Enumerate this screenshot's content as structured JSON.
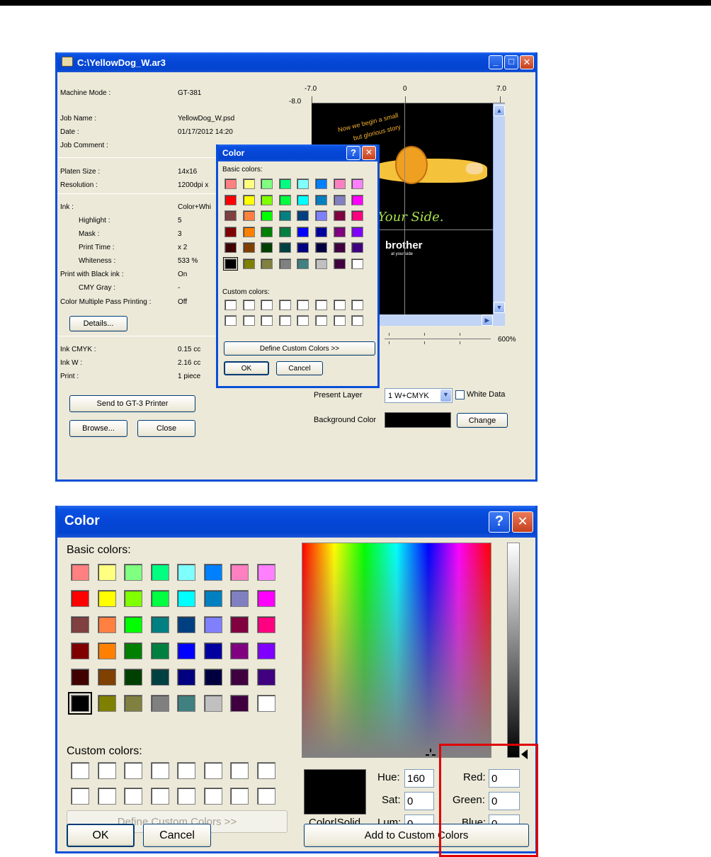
{
  "main_window": {
    "title": "C:\\YellowDog_W.ar3",
    "info": [
      {
        "label": "Machine Mode :",
        "value": "GT-381"
      },
      {
        "label": "Job Name :",
        "value": "YellowDog_W.psd"
      },
      {
        "label": "Date :",
        "value": "01/17/2012 14:20"
      },
      {
        "label": "Job Comment :",
        "value": ""
      },
      {
        "label": "Platen Size :",
        "value": "14x16"
      },
      {
        "label": "Resolution :",
        "value": "1200dpi x"
      },
      {
        "label": "Ink :",
        "value": "Color+Whi"
      },
      {
        "label": "Highlight :",
        "value": "5"
      },
      {
        "label": "Mask :",
        "value": "3"
      },
      {
        "label": "Print Time :",
        "value": "x 2"
      },
      {
        "label": "Whiteness :",
        "value": "533 %"
      },
      {
        "label": "Print with Black ink :",
        "value": "On"
      },
      {
        "label": "CMY Gray :",
        "value": "-"
      },
      {
        "label": "Color Multiple Pass Printing :",
        "value": "Off"
      },
      {
        "label": "Ink CMYK :",
        "value": "0.15 cc"
      },
      {
        "label": "Ink W :",
        "value": "2.16 cc"
      },
      {
        "label": "Print :",
        "value": "1 piece"
      }
    ],
    "details_button": "Details...",
    "send_button": "Send to GT-3 Printer",
    "browse_button": "Browse...",
    "close_button": "Close",
    "ruler": {
      "left": "-7.0",
      "center": "0",
      "right": "7.0",
      "top": "-8.0"
    },
    "zoom": "600%",
    "present_layer_label": "Present Layer",
    "present_layer_value": "1 W+CMYK",
    "white_data_label": "White Data",
    "background_color_label": "Background Color",
    "background_color_value": "#000000",
    "change_button": "Change",
    "preview_text": {
      "line1": "Now we begin a small",
      "line2": "but glorious story",
      "slogan": ". Your Side.",
      "brand": "brother",
      "brand_sub": "at your side"
    }
  },
  "color_dialog": {
    "title": "Color",
    "help": "?",
    "basic_colors_label": "Basic colors:",
    "custom_colors_label": "Custom colors:",
    "define_button": "Define Custom Colors >>",
    "ok_button": "OK",
    "cancel_button": "Cancel",
    "add_button": "Add to Custom Colors",
    "color_solid_label": "Color|Solid",
    "hue_label": "Hue:",
    "hue_value": "160",
    "sat_label": "Sat:",
    "sat_value": "0",
    "lum_label": "Lum:",
    "lum_value": "0",
    "red_label": "Red:",
    "red_value": "0",
    "green_label": "Green:",
    "green_value": "0",
    "blue_label": "Blue:",
    "blue_value": "0",
    "highlight_color": "#e00000"
  },
  "basic_colors": [
    "#ff8080",
    "#ffff80",
    "#80ff80",
    "#00ff80",
    "#80ffff",
    "#0080ff",
    "#ff80c0",
    "#ff80ff",
    "#ff0000",
    "#ffff00",
    "#80ff00",
    "#00ff40",
    "#00ffff",
    "#0080c0",
    "#8080c0",
    "#ff00ff",
    "#804040",
    "#ff8040",
    "#00ff00",
    "#008080",
    "#004080",
    "#8080ff",
    "#800040",
    "#ff0080",
    "#800000",
    "#ff8000",
    "#008000",
    "#008040",
    "#0000ff",
    "#0000a0",
    "#800080",
    "#8000ff",
    "#400000",
    "#804000",
    "#004000",
    "#004040",
    "#000080",
    "#000040",
    "#400040",
    "#400080",
    "#000000",
    "#808000",
    "#808040",
    "#808080",
    "#408080",
    "#c0c0c0",
    "#400040",
    "#ffffff"
  ]
}
